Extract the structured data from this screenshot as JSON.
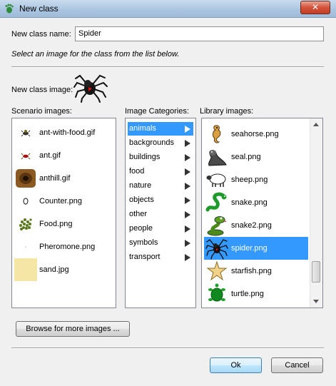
{
  "window": {
    "title": "New class",
    "close_label": "✕"
  },
  "form": {
    "name_label": "New class name:",
    "name_value": "Spider",
    "instruction": "Select an image for the class from the list below.",
    "image_label": "New class image:"
  },
  "scenario": {
    "label": "Scenario images:",
    "items": [
      {
        "label": "ant-with-food.gif",
        "icon": "ant-with-food-icon"
      },
      {
        "label": "ant.gif",
        "icon": "ant-icon"
      },
      {
        "label": "anthill.gif",
        "icon": "anthill-icon"
      },
      {
        "label": "Counter.png",
        "icon": "counter-icon"
      },
      {
        "label": "Food.png",
        "icon": "food-icon"
      },
      {
        "label": "Pheromone.png",
        "icon": "pheromone-icon"
      },
      {
        "label": "sand.jpg",
        "icon": "sand-icon"
      }
    ]
  },
  "categories": {
    "label": "Image Categories:",
    "selected": "animals",
    "items": [
      "animals",
      "backgrounds",
      "buildings",
      "food",
      "nature",
      "objects",
      "other",
      "people",
      "symbols",
      "transport"
    ]
  },
  "library": {
    "label": "Library images:",
    "selected": "spider.png",
    "items": [
      {
        "label": "seahorse.png",
        "icon": "seahorse-icon"
      },
      {
        "label": "seal.png",
        "icon": "seal-icon"
      },
      {
        "label": "sheep.png",
        "icon": "sheep-icon"
      },
      {
        "label": "snake.png",
        "icon": "snake-icon"
      },
      {
        "label": "snake2.png",
        "icon": "snake2-icon"
      },
      {
        "label": "spider.png",
        "icon": "spider-icon"
      },
      {
        "label": "starfish.png",
        "icon": "starfish-icon"
      },
      {
        "label": "turtle.png",
        "icon": "turtle-icon"
      }
    ]
  },
  "buttons": {
    "browse": "Browse for more images ...",
    "ok": "Ok",
    "cancel": "Cancel"
  },
  "colors": {
    "selection": "#3399ff",
    "accent_title": "#a9c4e0"
  }
}
